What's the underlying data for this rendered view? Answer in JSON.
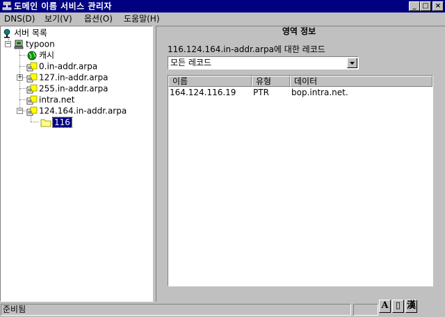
{
  "window": {
    "title": "도메인 이름 서비스 관리자",
    "min": "_",
    "max": "□",
    "close": "×"
  },
  "menu": [
    "DNS(D)",
    "보기(V)",
    "옵션(O)",
    "도움말(H)"
  ],
  "tree": {
    "root": "서버 목록",
    "server": "typoon",
    "children": [
      "캐시",
      "0.in-addr.arpa",
      "127.in-addr.arpa",
      "255.in-addr.arpa",
      "intra.net",
      "124.164.in-addr.arpa"
    ],
    "grandchild": "116"
  },
  "zone_info": {
    "title": "영역 정보",
    "label": "116.124.164.in-addr.arpa에 대한 레코드",
    "record_filter": "모든 레코드"
  },
  "records": {
    "columns": [
      "이름",
      "유형",
      "데이터"
    ],
    "rows": [
      {
        "name": "164.124.116.19",
        "type": "PTR",
        "data": "bop.intra.net."
      }
    ]
  },
  "status": {
    "text": "준비됨"
  },
  "ime": {
    "a": "A",
    "half": "▯",
    "han": "漢"
  }
}
